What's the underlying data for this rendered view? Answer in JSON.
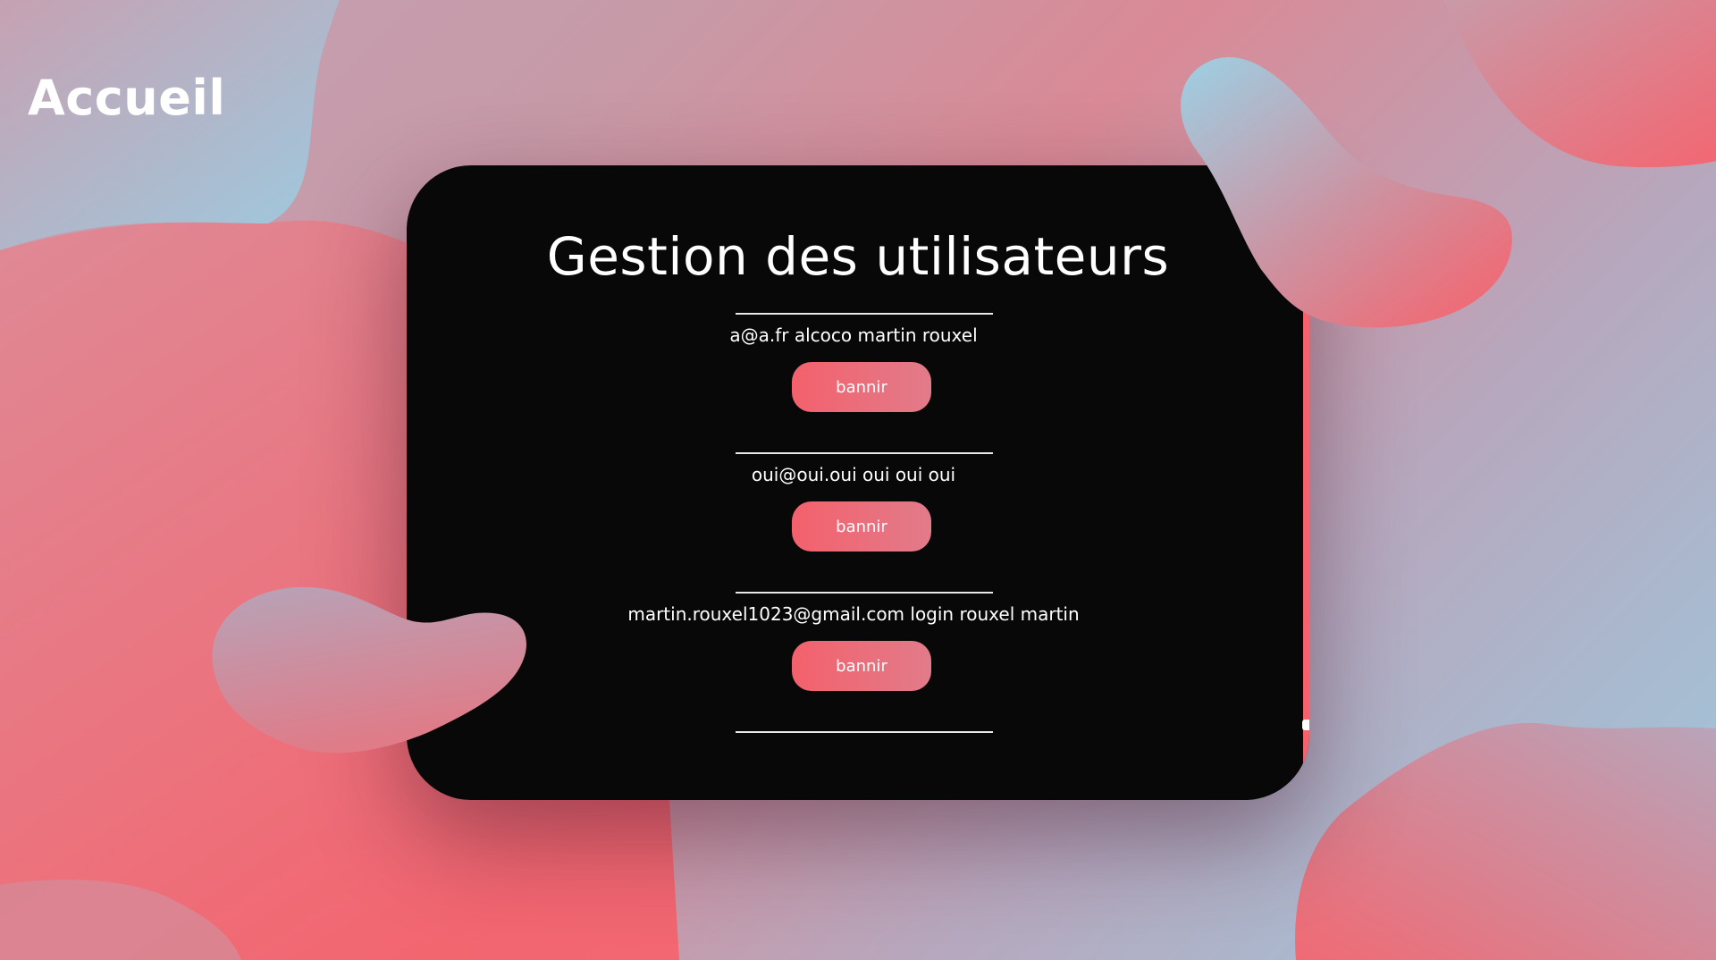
{
  "nav": {
    "home_label": "Accueil"
  },
  "panel": {
    "title": "Gestion des utilisateurs"
  },
  "users": [
    {
      "label": "a@a.fr alcoco martin rouxel",
      "ban_label": "bannir"
    },
    {
      "label": "oui@oui.oui oui oui oui",
      "ban_label": "bannir"
    },
    {
      "label": "martin.rouxel1023@gmail.com login rouxel martin",
      "ban_label": "bannir"
    }
  ],
  "colors": {
    "accent": "#f3616c",
    "card_background": "#080808",
    "text": "#ffffff",
    "blob_blue": "#9dcfe2",
    "blob_coral": "#f26570"
  }
}
